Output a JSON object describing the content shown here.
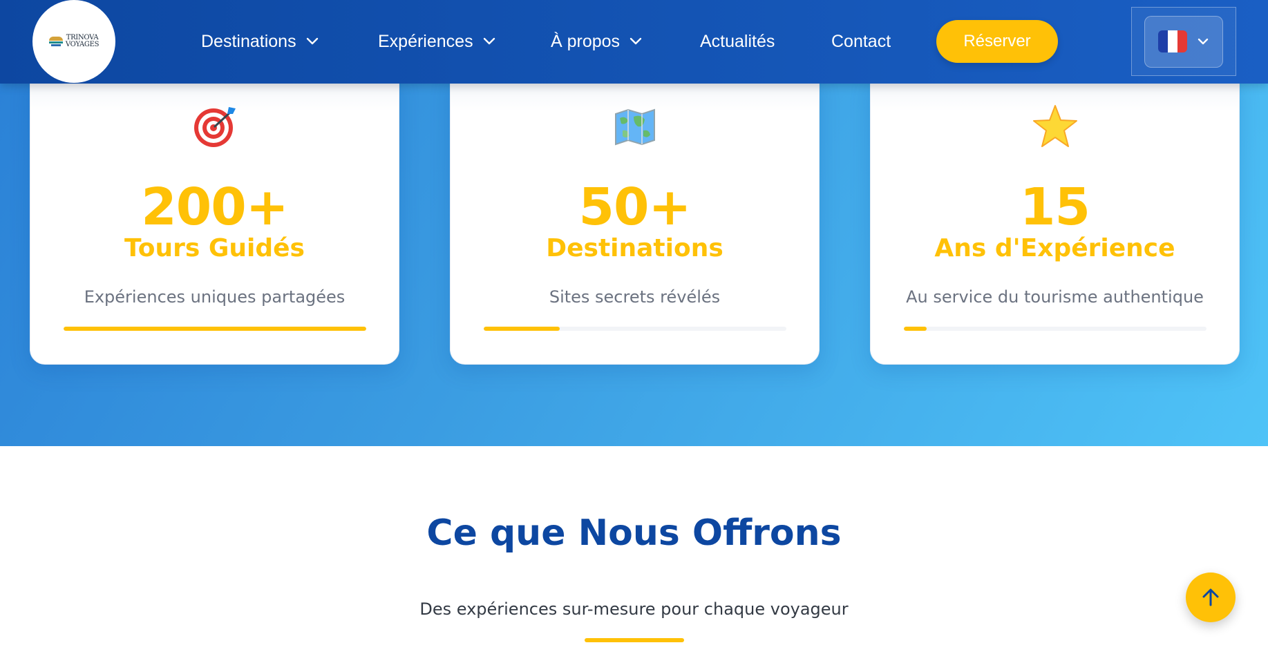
{
  "header": {
    "logo": {
      "line1": "TRINOVA",
      "line2": "VOYAGES"
    },
    "nav": [
      {
        "label": "Destinations",
        "has_dropdown": true
      },
      {
        "label": "Expériences",
        "has_dropdown": true
      },
      {
        "label": "À propos",
        "has_dropdown": true
      },
      {
        "label": "Actualités",
        "has_dropdown": false
      },
      {
        "label": "Contact",
        "has_dropdown": false
      }
    ],
    "reserve_label": "Réserver",
    "language": {
      "icon": "french-flag-icon",
      "selected": "FR"
    }
  },
  "stats": [
    {
      "icon": "target-icon",
      "value": "200+",
      "title": "Tours Guidés",
      "description": "Expériences uniques partagées",
      "progress": 1.0
    },
    {
      "icon": "world-map-icon",
      "value": "50+",
      "title": "Destinations",
      "description": "Sites secrets révélés",
      "progress": 0.25
    },
    {
      "icon": "star-icon",
      "value": "15",
      "title": "Ans d'Expérience",
      "description": "Au service du tourisme authentique",
      "progress": 0.075
    }
  ],
  "offer": {
    "title": "Ce que Nous Offrons",
    "subtitle": "Des expériences sur-mesure pour chaque voyageur"
  },
  "colors": {
    "brand_blue": "#0d47a1",
    "accent_yellow": "#ffc107",
    "hero_gradient_start": "#2a80d6",
    "hero_gradient_end": "#4fc3f7"
  }
}
